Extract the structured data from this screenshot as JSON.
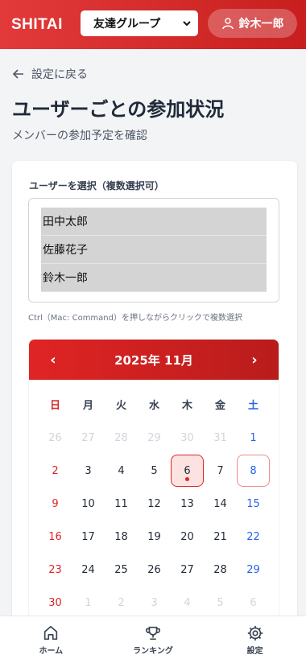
{
  "header": {
    "logo": "SHITAI",
    "group_select": "友達グループ",
    "user_name": "鈴木一郎"
  },
  "back_label": "設定に戻る",
  "title": "ユーザーごとの参加状況",
  "subtitle": "メンバーの参加予定を確認",
  "user_select": {
    "label": "ユーザーを選択（複数選択可）",
    "options": [
      "田中太郎",
      "佐藤花子",
      "鈴木一郎"
    ],
    "hint": "Ctrl（Mac: Command）を押しながらクリックで複数選択"
  },
  "calendar": {
    "month_label": "2025年 11月",
    "weekdays": [
      "日",
      "月",
      "火",
      "水",
      "木",
      "金",
      "土"
    ],
    "weeks": [
      [
        "26",
        "27",
        "28",
        "29",
        "30",
        "31",
        "1"
      ],
      [
        "2",
        "3",
        "4",
        "5",
        "6",
        "7",
        "8"
      ],
      [
        "9",
        "10",
        "11",
        "12",
        "13",
        "14",
        "15"
      ],
      [
        "16",
        "17",
        "18",
        "19",
        "20",
        "21",
        "22"
      ],
      [
        "23",
        "24",
        "25",
        "26",
        "27",
        "28",
        "29"
      ],
      [
        "30",
        "1",
        "2",
        "3",
        "4",
        "5",
        "6"
      ]
    ]
  },
  "bottom_nav": {
    "home": "ホーム",
    "ranking": "ランキング",
    "settings": "設定"
  }
}
